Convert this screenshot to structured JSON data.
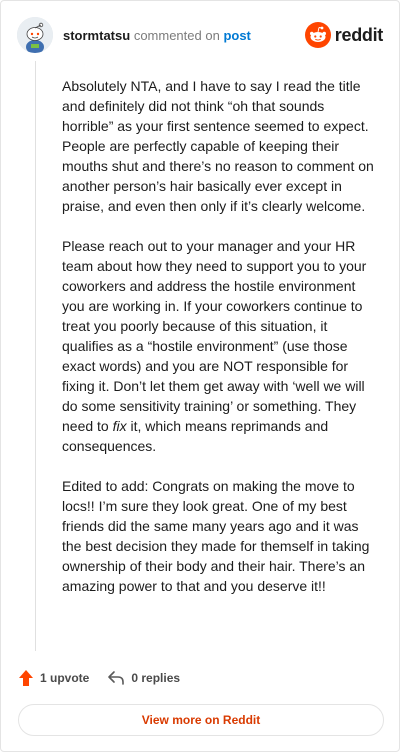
{
  "header": {
    "username": "stormtatsu",
    "action_text": "commented on",
    "post_link": "post",
    "brand_name": "reddit"
  },
  "comment": {
    "p1": "Absolutely NTA, and I have to say I read the title and definitely did not think “oh that sounds horrible” as your first sentence seemed to expect. People are perfectly capable of keeping their mouths shut and there’s no reason to comment on another person’s hair basically ever except in praise, and even then only if it’s clearly welcome.",
    "p2_before": "Please reach out to your manager and your HR team about how they need to support you to your coworkers and address the hostile environment you are working in. If your coworkers continue to treat you poorly because of this situation, it qualifies as a “hostile environment” (use those exact words) and you are NOT responsible for fixing it. Don’t let them get away with ‘well we will do some sensitivity training’ or something. They need to ",
    "p2_emph": "fix",
    "p2_after": " it, which means reprimands and consequences.",
    "p3": "Edited to add: Congrats on making the move to locs!! I’m sure they look great. One of my best friends did the same many years ago and it was the best decision they made for themself in taking ownership of their body and their hair. There’s an amazing power to that and you deserve it!!"
  },
  "actions": {
    "upvote_label": "1 upvote",
    "replies_label": "0 replies"
  },
  "footer": {
    "view_more_label": "View more on Reddit"
  },
  "colors": {
    "brand_orange": "#ff4500",
    "link_blue": "#0079d3",
    "view_more_text": "#d93a00"
  }
}
